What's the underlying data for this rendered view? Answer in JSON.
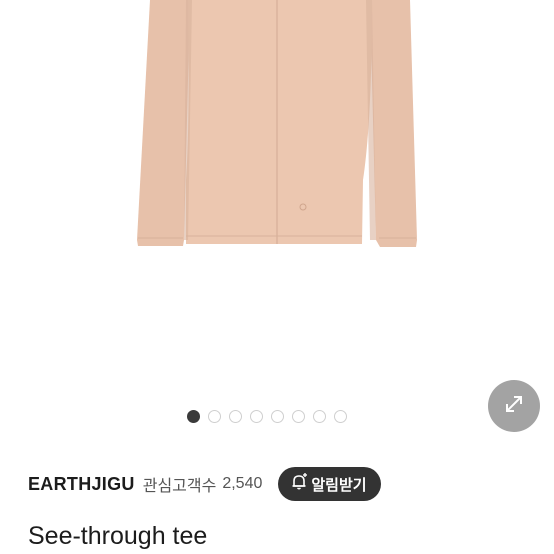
{
  "brand": {
    "name": "EARTHJIGU",
    "favorites_label": "관심고객수",
    "favorites_count": "2,540"
  },
  "notify_button": {
    "label": "알림받기"
  },
  "product": {
    "title": "See-through tee",
    "color": "#e9c3ac"
  },
  "carousel": {
    "total": 8,
    "active_index": 1
  },
  "icons": {
    "expand": "expand-diagonal-icon",
    "bell": "bell-plus-icon"
  }
}
